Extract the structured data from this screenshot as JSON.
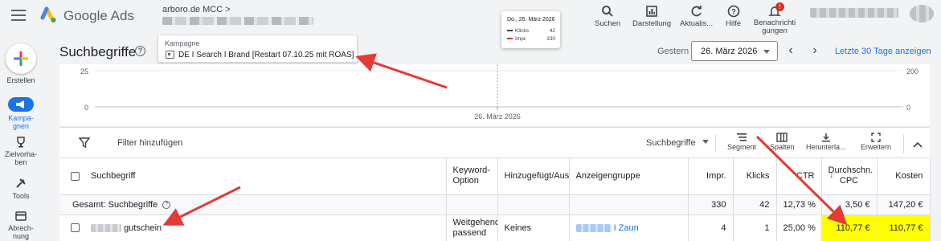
{
  "app": {
    "brand": "Google Ads",
    "account": "arboro.de MCC",
    "account_chevron": ">"
  },
  "topbar_buttons": [
    {
      "label": "Suchen",
      "icon": "search-icon"
    },
    {
      "label": "Darstellung",
      "icon": "chart-icon"
    },
    {
      "label": "Aktualis...",
      "icon": "refresh-icon"
    },
    {
      "label": "Hilfe",
      "icon": "help-icon"
    },
    {
      "label": "Benachrichti\ngungen",
      "icon": "bell-icon",
      "badge": "!"
    }
  ],
  "rail": {
    "create": "Erstellen",
    "campaigns": "Kampa-\ngnen",
    "goals": "Zielvorha-\nben",
    "tools": "Tools",
    "billing": "Abrech-\nnung"
  },
  "page": {
    "title": "Suchbegriffe",
    "campaign_label": "Kampagne",
    "campaign_name": "DE I Search I Brand [Restart 07.10.25 mit ROAS]",
    "date_prefix": "Gestern",
    "date_value": "26. März 2026",
    "last30": "Letzte 30 Tage anzeigen"
  },
  "tooltip": {
    "date": "Do., 26. März 2026",
    "rows": [
      {
        "label": "Klicks",
        "value": "42",
        "color": "#3c4043"
      },
      {
        "label": "Impr.",
        "value": "330",
        "color": "#d93025"
      }
    ]
  },
  "chart_data": {
    "type": "line",
    "x": [
      "26. März 2026"
    ],
    "series": [
      {
        "name": "Klicks",
        "values": [
          42
        ],
        "axis": "left",
        "color": "#3c4043"
      },
      {
        "name": "Impr.",
        "values": [
          330
        ],
        "axis": "right",
        "color": "#d93025"
      }
    ],
    "y_left_ticks": [
      "25",
      "0"
    ],
    "y_right_ticks": [
      "200",
      "0"
    ],
    "xlabel_tick": "26. März 2026"
  },
  "toolbar": {
    "filter": "Filter hinzufügen",
    "view": "Suchbegriffe",
    "segment": "Segment",
    "columns": "Spalten",
    "download": "Herunterla...",
    "expand": "Erweitern"
  },
  "table": {
    "headers": {
      "term": "Suchbegriff",
      "match": "Keyword-Option",
      "added": "Hinzugefügt/Ausg",
      "adgroup": "Anzeigengruppe",
      "impr": "Impr.",
      "clicks": "Klicks",
      "ctr": "CTR",
      "cpc": "Durchschn. CPC",
      "cost": "Kosten"
    },
    "total": {
      "label": "Gesamt: Suchbegriffe",
      "impr": "330",
      "clicks": "42",
      "ctr": "12,73 %",
      "cpc": "3,50 €",
      "cost": "147,20 €"
    },
    "rows": [
      {
        "term": "gutschein",
        "match": "Weitgehend passend",
        "added": "Keines",
        "adgroup": "I Zaun",
        "impr": "4",
        "clicks": "1",
        "ctr": "25,00 %",
        "cpc": "110,77 €",
        "cost": "110,77 €"
      }
    ]
  },
  "colors": {
    "accent": "#1a73e8",
    "highlight": "#ffff00",
    "annotation": "#e53935"
  }
}
